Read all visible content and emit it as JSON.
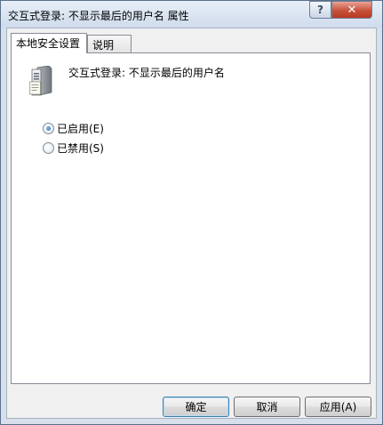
{
  "window": {
    "title": "交互式登录: 不显示最后的用户名 属性",
    "help_label": "?",
    "close_label": "✕"
  },
  "tabs": [
    {
      "label": "本地安全设置",
      "active": true
    },
    {
      "label": "说明",
      "active": false
    }
  ],
  "policy": {
    "icon": "server-policy-icon",
    "name": "交互式登录: 不显示最后的用户名"
  },
  "options": [
    {
      "label": "已启用(E)",
      "selected": true
    },
    {
      "label": "已禁用(S)",
      "selected": false
    }
  ],
  "buttons": {
    "ok": "确定",
    "cancel": "取消",
    "apply": "应用(A)"
  }
}
